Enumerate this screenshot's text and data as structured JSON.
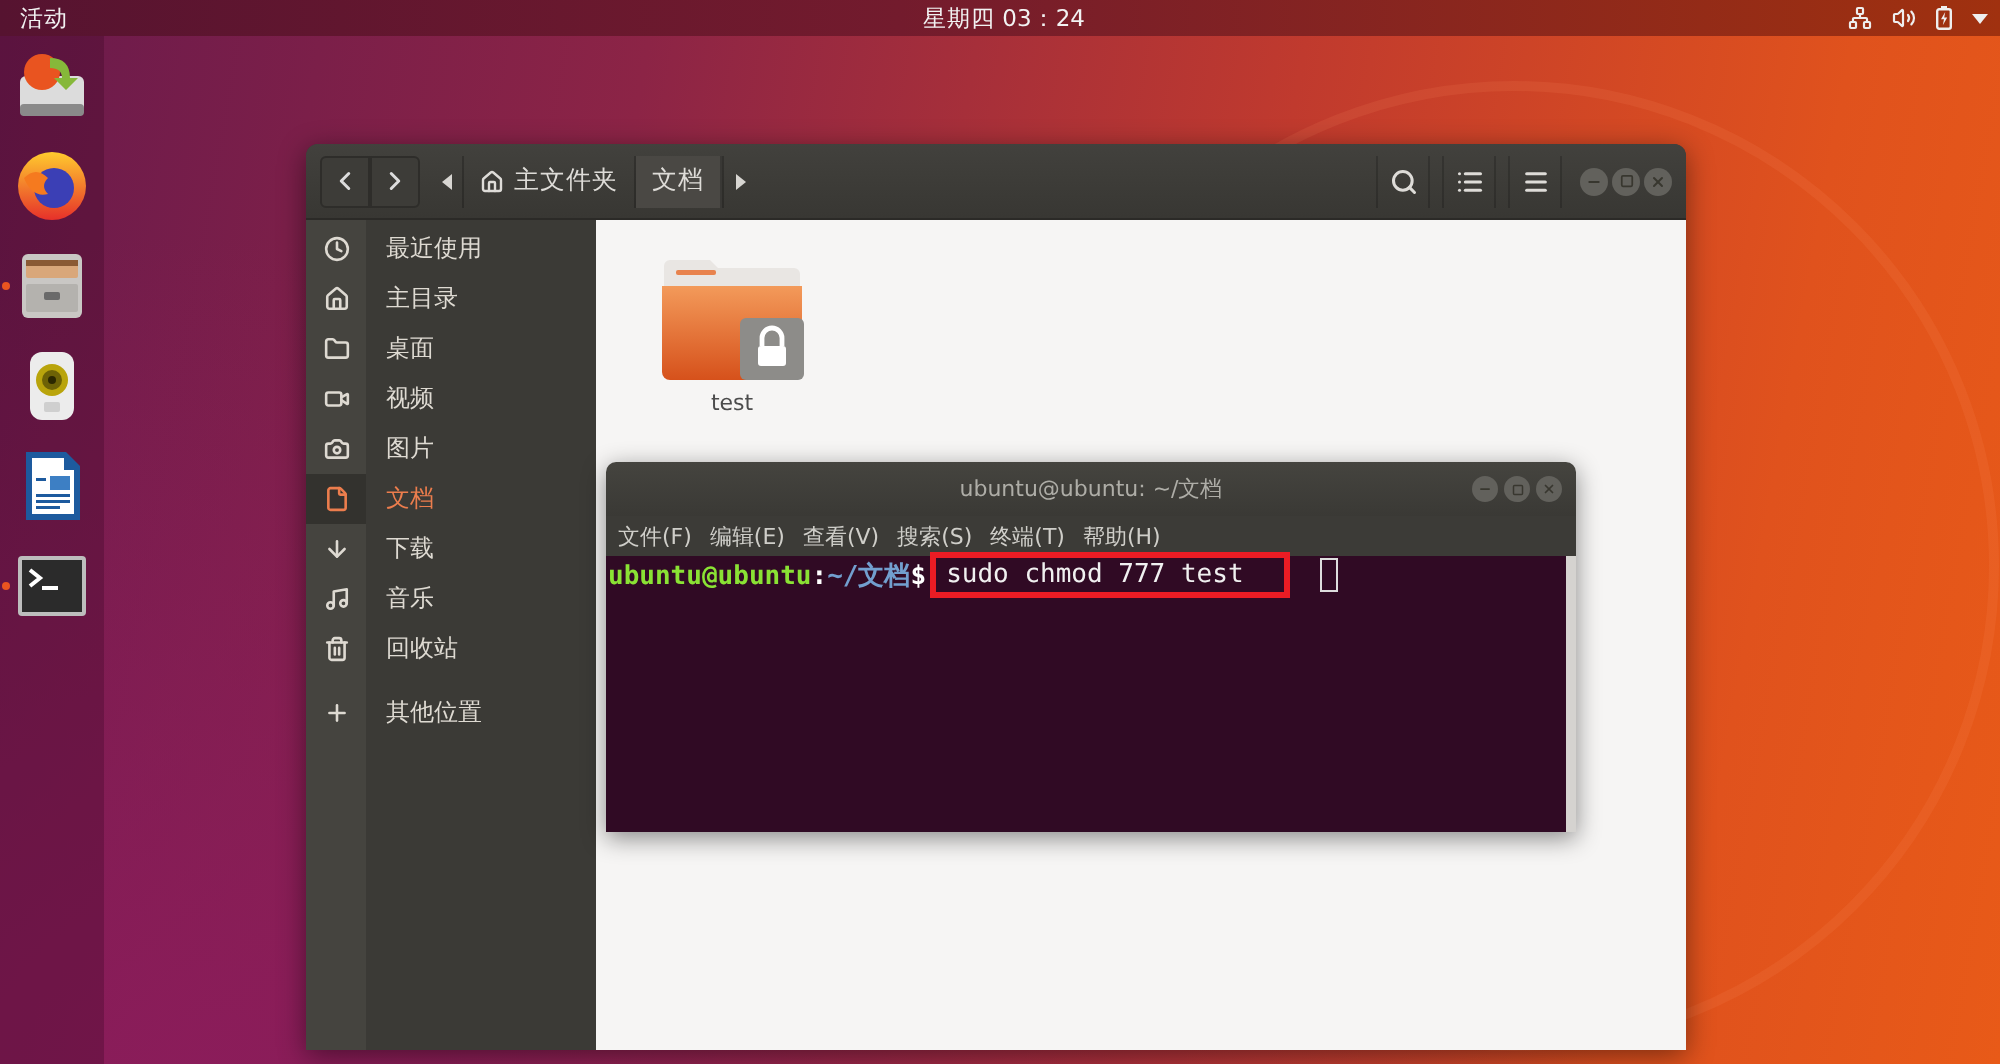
{
  "top_bar": {
    "activities": "活动",
    "clock": "星期四 03：24"
  },
  "dock": {
    "items": [
      {
        "kind": "installer",
        "running": false
      },
      {
        "kind": "browser",
        "running": false
      },
      {
        "kind": "files",
        "running": true
      },
      {
        "kind": "speaker",
        "running": false
      },
      {
        "kind": "writer",
        "running": false
      },
      {
        "kind": "terminal",
        "running": true
      }
    ]
  },
  "file_manager": {
    "path": [
      {
        "label": "主文件夹",
        "kind": "home",
        "selected": false
      },
      {
        "label": "文档",
        "kind": "folder",
        "selected": true
      }
    ],
    "sidebar": [
      {
        "label": "最近使用",
        "kind": "recent",
        "selected": false
      },
      {
        "label": "主目录",
        "kind": "home",
        "selected": false
      },
      {
        "label": "桌面",
        "kind": "desktop",
        "selected": false
      },
      {
        "label": "视频",
        "kind": "videos",
        "selected": false
      },
      {
        "label": "图片",
        "kind": "pictures",
        "selected": false
      },
      {
        "label": "文档",
        "kind": "documents",
        "selected": true
      },
      {
        "label": "下载",
        "kind": "downloads",
        "selected": false
      },
      {
        "label": "音乐",
        "kind": "music",
        "selected": false
      },
      {
        "label": "回收站",
        "kind": "trash",
        "selected": false
      },
      {
        "label": "其他位置",
        "kind": "other",
        "selected": false
      }
    ],
    "files": [
      {
        "name": "test",
        "locked": true
      }
    ]
  },
  "terminal": {
    "title": "ubuntu@ubuntu: ~/文档",
    "menu": [
      "文件(F)",
      "编辑(E)",
      "查看(V)",
      "搜索(S)",
      "终端(T)",
      "帮助(H)"
    ],
    "prompt": {
      "user": "ubuntu@ubuntu",
      "separator": ":",
      "path": "~/文档",
      "symbol": "$"
    },
    "command": "sudo chmod 777 test",
    "highlighted": true
  }
}
